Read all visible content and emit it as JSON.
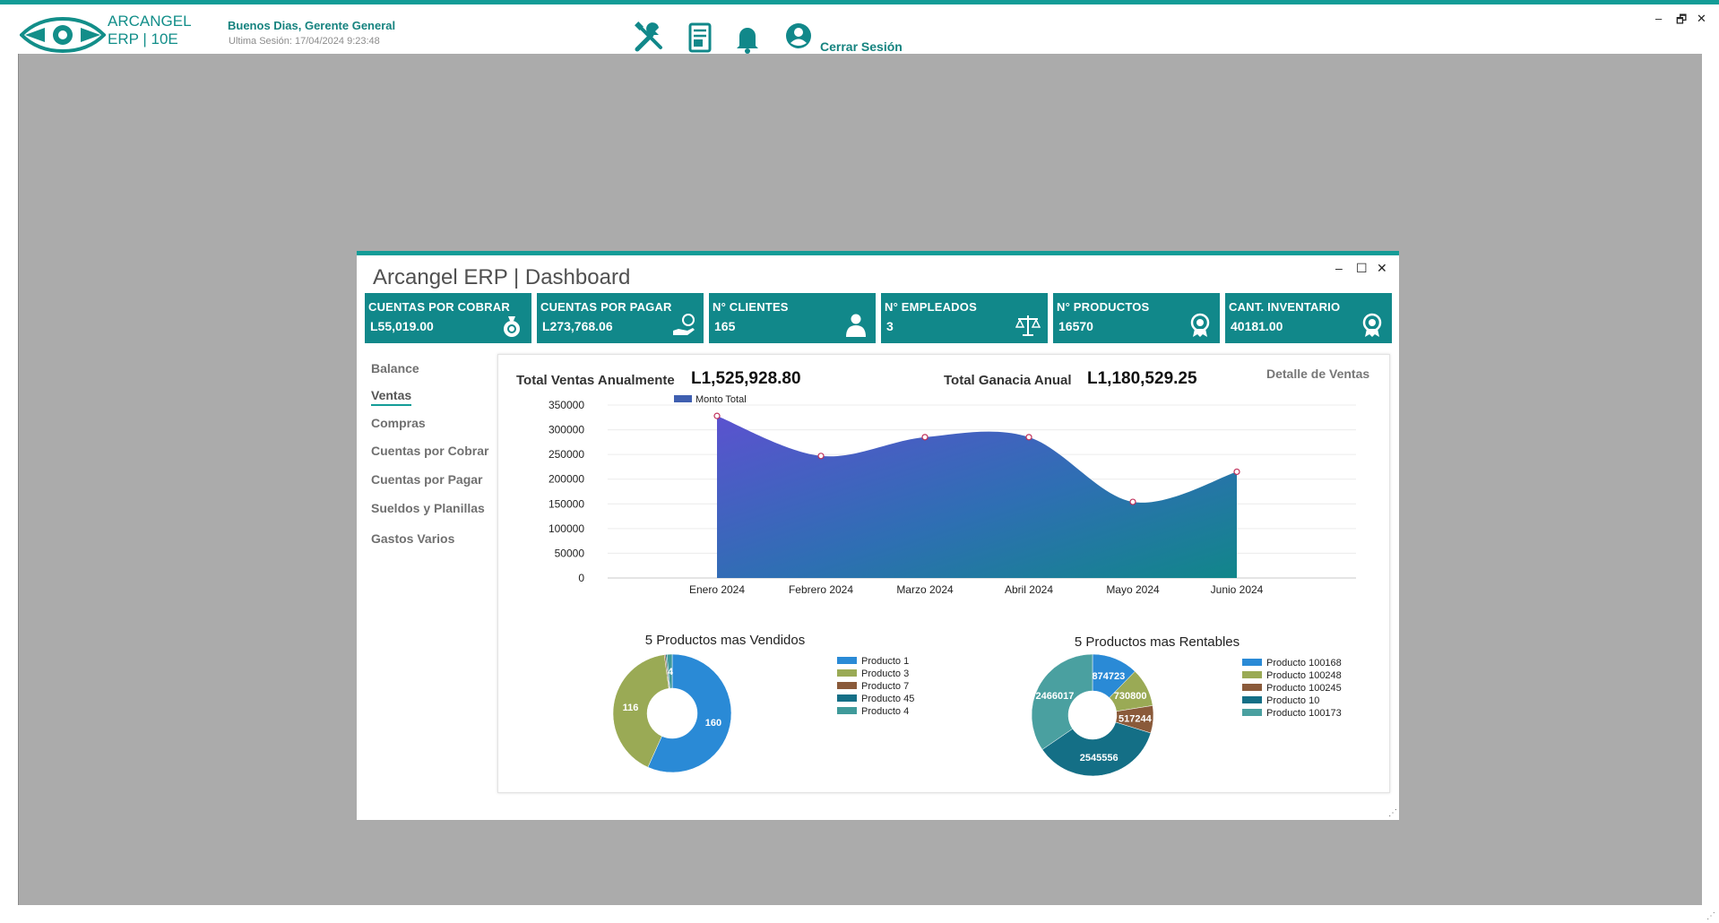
{
  "app": {
    "logo_line1": "ARCANGEL",
    "logo_line2": "ERP | 10E",
    "greeting": "Buenos Dias, Gerente General",
    "last_session": "Ultima Sesión: 17/04/2024 9:23:48",
    "logout": "Cerrar Sesión",
    "icons": [
      "tools-icon",
      "report-icon",
      "bell-icon",
      "user-icon"
    ],
    "window_controls": [
      "–",
      "🗗",
      "✕"
    ]
  },
  "dashboard": {
    "title": "Arcangel ERP | Dashboard",
    "controls": [
      "–",
      "☐",
      "✕"
    ],
    "cards": [
      {
        "label": "CUENTAS POR COBRAR",
        "value": "L55,019.00",
        "icon": "money-bag-icon"
      },
      {
        "label": "CUENTAS POR PAGAR",
        "value": "L273,768.06",
        "icon": "hand-coin-icon"
      },
      {
        "label": "N° CLIENTES",
        "value": "165",
        "icon": "person-icon"
      },
      {
        "label": "N° EMPLEADOS",
        "value": "3",
        "icon": "scale-icon"
      },
      {
        "label": "N° PRODUCTOS",
        "value": "16570",
        "icon": "award-icon"
      },
      {
        "label": "CANT. INVENTARIO",
        "value": "40181.00",
        "icon": "award-icon"
      }
    ],
    "menu": [
      {
        "label": "Balance",
        "active": false
      },
      {
        "label": "Ventas",
        "active": true
      },
      {
        "label": "Compras",
        "active": false
      },
      {
        "label": "Cuentas por Cobrar",
        "active": false
      },
      {
        "label": "Cuentas por Pagar",
        "active": false
      },
      {
        "label": "Sueldos y Planillas",
        "active": false
      },
      {
        "label": "Gastos Varios",
        "active": false
      }
    ],
    "summary": {
      "total_ventas_label": "Total Ventas Anualmente",
      "total_ventas_value": "L1,525,928.80",
      "total_ganancia_label": "Total Ganacia Anual",
      "total_ganancia_value": "L1,180,529.25",
      "detalle": "Detalle de Ventas"
    },
    "colors": {
      "accent": "#139c97",
      "card": "#11888a"
    }
  },
  "chart_data": [
    {
      "type": "area",
      "title": "",
      "categories": [
        "Enero 2024",
        "Febrero 2024",
        "Marzo 2024",
        "Abril 2024",
        "Mayo 2024",
        "Junio 2024"
      ],
      "series": [
        {
          "name": "Monto Total",
          "values": [
            328000,
            247000,
            285000,
            285000,
            154000,
            215000
          ]
        }
      ],
      "y_ticks": [
        "0",
        "50000",
        "100000",
        "150000",
        "200000",
        "250000",
        "300000",
        "350000"
      ],
      "ylim": [
        0,
        350000
      ],
      "grid": true,
      "legend": "top-left"
    },
    {
      "type": "pie",
      "title": "5 Productos mas Vendidos",
      "labels": [
        "Producto 1",
        "Producto 3",
        "Producto 7",
        "Producto 45",
        "Producto 4"
      ],
      "values": [
        160,
        116,
        1,
        1,
        4
      ],
      "slice_labels": [
        "160",
        "116",
        "",
        "",
        "4"
      ],
      "colors": [
        "#2a8ad6",
        "#9aaa55",
        "#8a5a3a",
        "#146f86",
        "#3f9a9a"
      ],
      "legend": "right"
    },
    {
      "type": "pie",
      "title": "5 Productos mas Rentables",
      "labels": [
        "Producto 100168",
        "Producto 100248",
        "Producto 100245",
        "Producto 10",
        "Producto 100173"
      ],
      "values": [
        874723,
        730800,
        517244,
        2545556,
        2466017
      ],
      "slice_labels": [
        "874723",
        "730800",
        "517244",
        "2545556",
        "2466017"
      ],
      "colors": [
        "#2a8ad6",
        "#9aaa55",
        "#8a5a3a",
        "#146f86",
        "#4aa0a0"
      ],
      "legend": "right"
    }
  ]
}
